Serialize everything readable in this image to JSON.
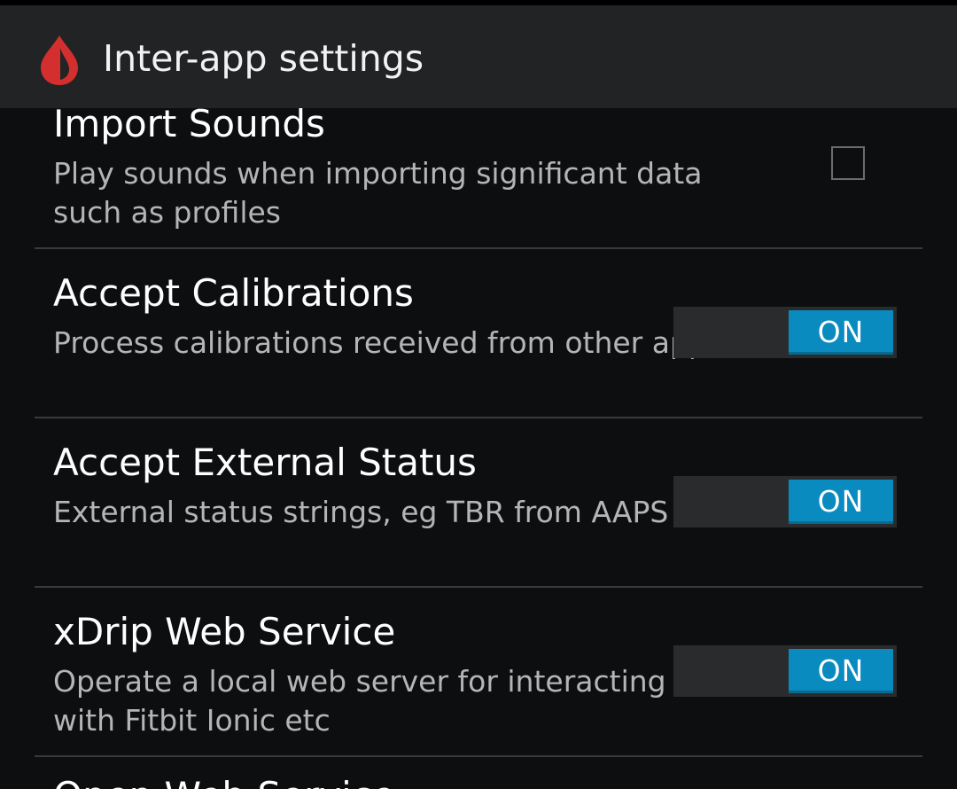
{
  "header": {
    "title": "Inter-app settings",
    "icon": "blood-drop-icon",
    "icon_color": "#d32f2f"
  },
  "preferences": [
    {
      "title": "Import Sounds",
      "summary": "Play sounds when importing significant data such as profiles",
      "control": "checkbox",
      "checked": false
    },
    {
      "title": "Accept Calibrations",
      "summary": "Process calibrations received from other apps",
      "control": "switch",
      "state_label": "ON"
    },
    {
      "title": "Accept External Status",
      "summary": "External status strings, eg TBR from AAPS",
      "control": "switch",
      "state_label": "ON"
    },
    {
      "title": "xDrip Web Service",
      "summary": "Operate a local web server for interacting with Fitbit Ionic etc",
      "control": "switch",
      "state_label": "ON"
    },
    {
      "title": "Open Web Service",
      "summary": "",
      "control": "unknown"
    }
  ],
  "colors": {
    "background": "#0d0e10",
    "action_bar": "#222324",
    "switch_on": "#0a8bbf",
    "divider": "#3a3a3a"
  }
}
